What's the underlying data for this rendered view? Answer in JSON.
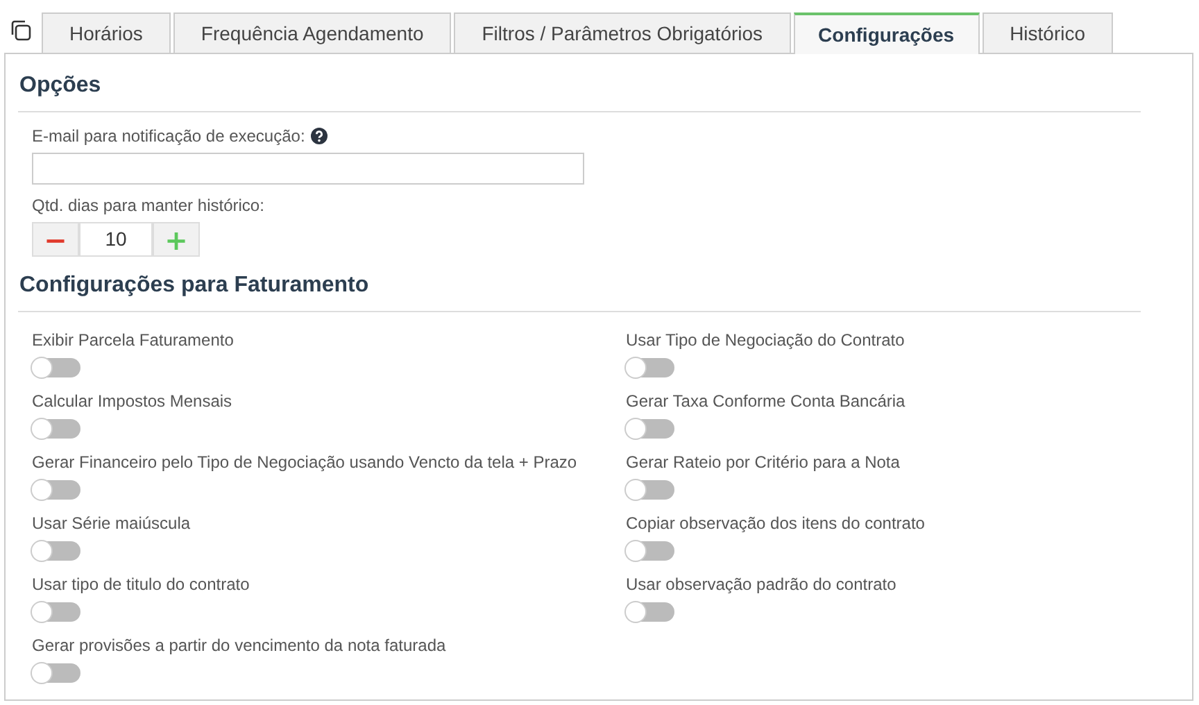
{
  "tabs": [
    {
      "label": "Horários",
      "selected": false
    },
    {
      "label": "Frequência Agendamento",
      "selected": false
    },
    {
      "label": "Filtros / Parâmetros Obrigatórios",
      "selected": false
    },
    {
      "label": "Configurações",
      "selected": true
    },
    {
      "label": "Histórico",
      "selected": false
    }
  ],
  "options": {
    "title": "Opções",
    "email": {
      "label": "E-mail para notificação de execução:"
    },
    "days": {
      "label": "Qtd. dias para manter histórico:",
      "minus": "−",
      "value": "10",
      "plus": "+"
    }
  },
  "billing": {
    "title": "Configurações para Faturamento",
    "left": [
      {
        "label": "Exibir Parcela Faturamento",
        "on": false
      },
      {
        "label": "Calcular Impostos Mensais",
        "on": false
      },
      {
        "label": "Gerar Financeiro pelo Tipo de Negociação usando Vencto da tela + Prazo",
        "on": false
      },
      {
        "label": "Usar Série maiúscula",
        "on": false
      },
      {
        "label": "Usar tipo de titulo do contrato",
        "on": false
      },
      {
        "label": "Gerar provisões a partir do vencimento da nota faturada",
        "on": false
      }
    ],
    "right": [
      {
        "label": "Usar Tipo de Negociação do Contrato",
        "on": false
      },
      {
        "label": "Gerar Taxa Conforme Conta Bancária",
        "on": false
      },
      {
        "label": "Gerar Rateio por Critério para a Nota",
        "on": false
      },
      {
        "label": "Copiar observação dos itens do contrato",
        "on": false
      },
      {
        "label": "Usar observação padrão do contrato",
        "on": false
      }
    ]
  }
}
